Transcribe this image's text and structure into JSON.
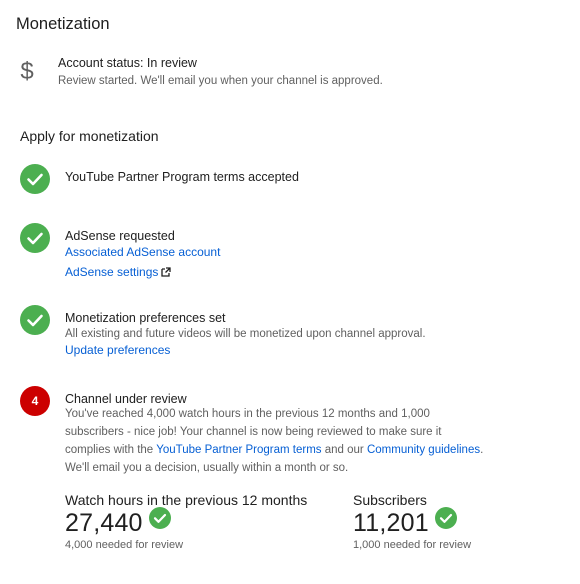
{
  "page": {
    "title": "Monetization"
  },
  "account": {
    "icon": "dollar-icon",
    "status": "Account status: In review",
    "subtitle": "Review started. We'll email you when your channel is approved."
  },
  "apply": {
    "title": "Apply for monetization",
    "steps": [
      {
        "status": "complete",
        "title": "YouTube Partner Program terms accepted"
      },
      {
        "status": "complete",
        "title": "AdSense requested",
        "links": [
          "Associated AdSense account",
          "AdSense settings"
        ]
      },
      {
        "status": "complete",
        "title": "Monetization preferences set",
        "description": "All existing and future videos will be monetized upon channel approval.",
        "links": [
          "Update preferences"
        ]
      },
      {
        "status": "in-progress",
        "number": "4",
        "title": "Channel under review",
        "description_lines": [
          "You've reached 4,000 watch hours in the previous 12 months and 1,000",
          "subscribers - nice job! Your channel is now being reviewed to make sure it",
          "complies with the ",
          "YouTube Partner Program terms",
          " and our ",
          "Community guidelines",
          ".",
          "We'll email you a decision, usually within a month or so."
        ]
      }
    ]
  },
  "metrics": {
    "watch_hours": {
      "label": "Watch hours in the previous 12 months",
      "value": "27,440",
      "sub": "4,000 needed for review"
    },
    "subscribers": {
      "label": "Subscribers",
      "value": "11,201",
      "sub": "1,000 needed for review"
    }
  },
  "colors": {
    "success": "#4caf50",
    "step_active": "#cc0000",
    "link": "#065fd4",
    "secondary_text": "#606060"
  }
}
